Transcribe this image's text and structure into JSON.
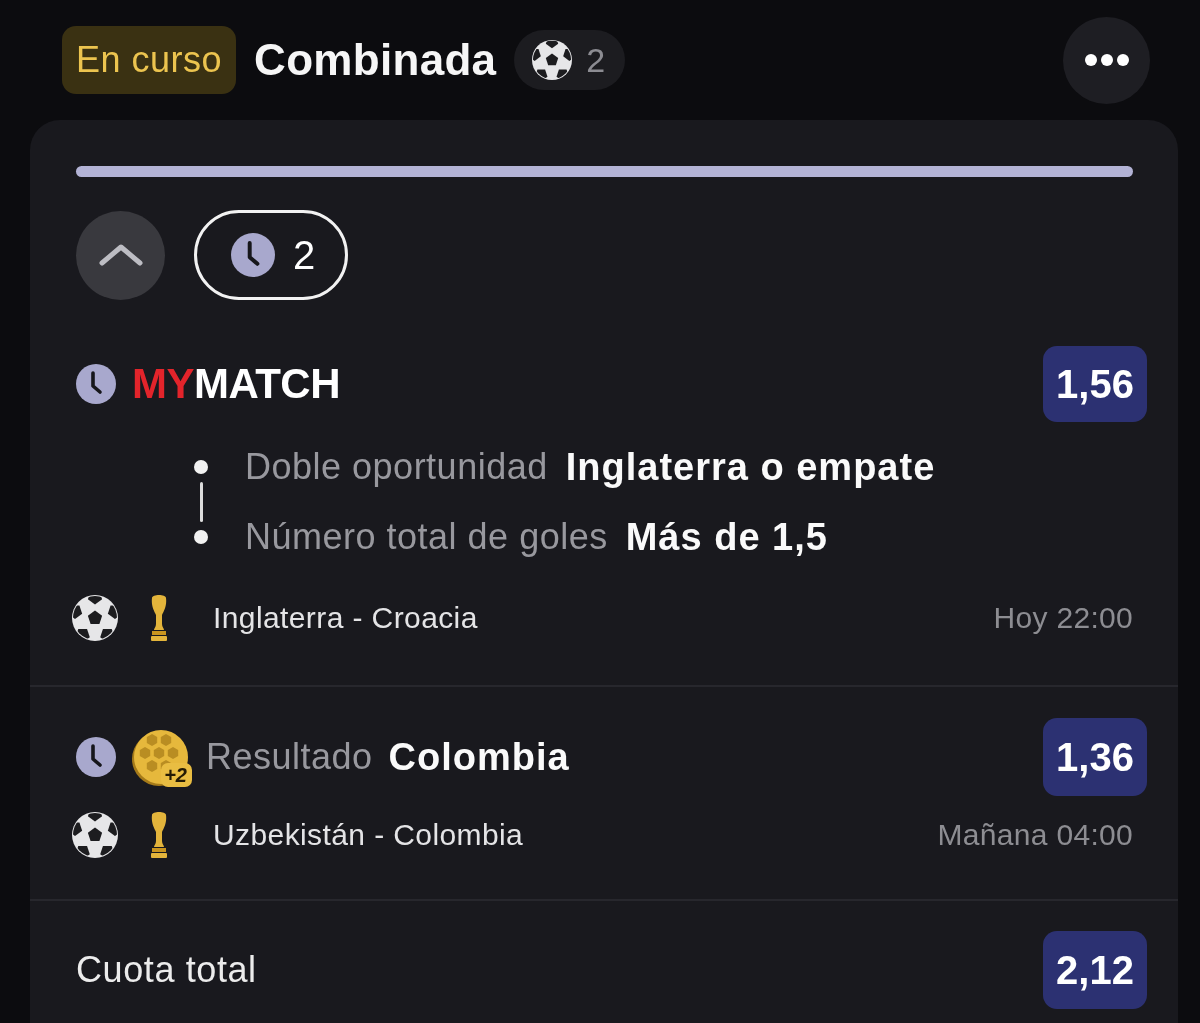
{
  "header": {
    "status": "En curso",
    "title": "Combinada",
    "sport_count": "2"
  },
  "card": {
    "expanded": true,
    "pending_count": "2"
  },
  "bets": [
    {
      "kind": "mymatch",
      "pending": true,
      "logo": {
        "accent": "MY",
        "rest": "MATCH"
      },
      "odds": "1,56",
      "selections": [
        {
          "market": "Doble oportunidad",
          "pick": "Inglaterra o empate"
        },
        {
          "market": "Número total de goles",
          "pick": "Más de 1,5"
        }
      ],
      "event": {
        "teams": "Inglaterra - Croacia",
        "time": "Hoy 22:00"
      }
    },
    {
      "kind": "single",
      "pending": true,
      "bonus": "+2",
      "market": "Resultado",
      "pick": "Colombia",
      "odds": "1,36",
      "event": {
        "teams": "Uzbekistán - Colombia",
        "time": "Mañana 04:00"
      }
    }
  ],
  "total": {
    "label": "Cuota total",
    "odds": "2,12"
  }
}
